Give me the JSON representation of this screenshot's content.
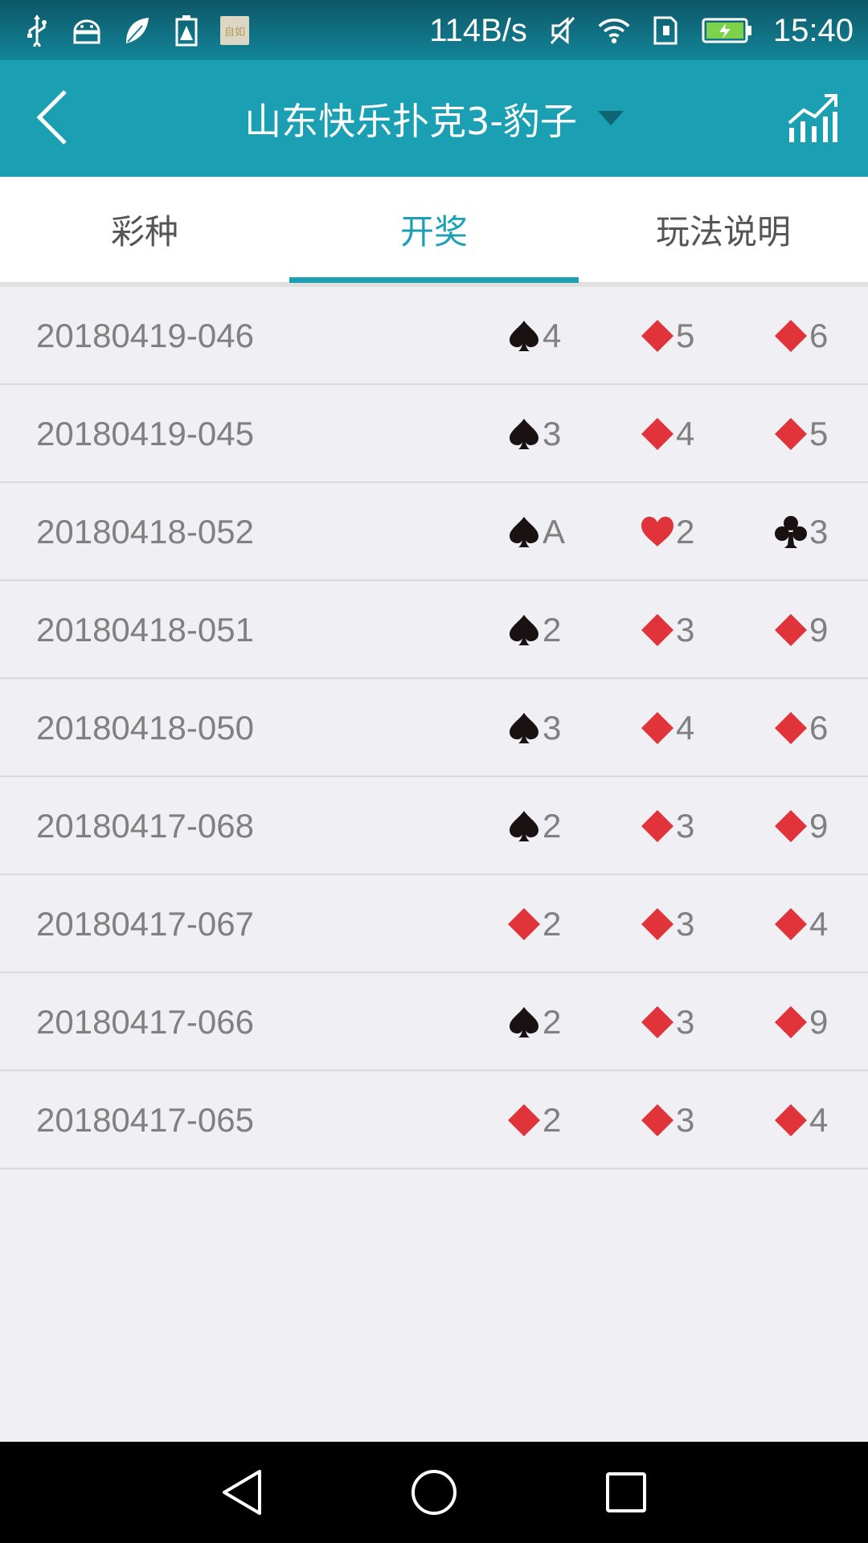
{
  "status_bar": {
    "net_speed": "114B/s",
    "time": "15:40",
    "notif_thumb_text": "自如",
    "icons": [
      "usb-icon",
      "android-icon",
      "leaf-icon",
      "battery-warning-icon",
      "notification-thumb",
      "mute-icon",
      "wifi-icon",
      "sim-icon",
      "battery-charging-icon"
    ]
  },
  "header": {
    "title": "山东快乐扑克3-豹子",
    "back_icon": "back-arrow-icon",
    "dropdown_icon": "dropdown-triangle-icon",
    "chart_icon": "trend-chart-icon"
  },
  "tabs": [
    {
      "label": "彩种",
      "active": false
    },
    {
      "label": "开奖",
      "active": true
    },
    {
      "label": "玩法说明",
      "active": false
    }
  ],
  "colors": {
    "accent": "#1a9fb3",
    "red_suit": "#e0343a",
    "black_suit": "#1a1212",
    "text_gray": "#808080"
  },
  "results": [
    {
      "issue": "20180419-046",
      "cards": [
        {
          "suit": "spade",
          "rank": "4"
        },
        {
          "suit": "diamond",
          "rank": "5"
        },
        {
          "suit": "diamond",
          "rank": "6"
        }
      ]
    },
    {
      "issue": "20180419-045",
      "cards": [
        {
          "suit": "spade",
          "rank": "3"
        },
        {
          "suit": "diamond",
          "rank": "4"
        },
        {
          "suit": "diamond",
          "rank": "5"
        }
      ]
    },
    {
      "issue": "20180418-052",
      "cards": [
        {
          "suit": "spade",
          "rank": "A"
        },
        {
          "suit": "heart",
          "rank": "2"
        },
        {
          "suit": "club",
          "rank": "3"
        }
      ]
    },
    {
      "issue": "20180418-051",
      "cards": [
        {
          "suit": "spade",
          "rank": "2"
        },
        {
          "suit": "diamond",
          "rank": "3"
        },
        {
          "suit": "diamond",
          "rank": "9"
        }
      ]
    },
    {
      "issue": "20180418-050",
      "cards": [
        {
          "suit": "spade",
          "rank": "3"
        },
        {
          "suit": "diamond",
          "rank": "4"
        },
        {
          "suit": "diamond",
          "rank": "6"
        }
      ]
    },
    {
      "issue": "20180417-068",
      "cards": [
        {
          "suit": "spade",
          "rank": "2"
        },
        {
          "suit": "diamond",
          "rank": "3"
        },
        {
          "suit": "diamond",
          "rank": "9"
        }
      ]
    },
    {
      "issue": "20180417-067",
      "cards": [
        {
          "suit": "diamond",
          "rank": "2"
        },
        {
          "suit": "diamond",
          "rank": "3"
        },
        {
          "suit": "diamond",
          "rank": "4"
        }
      ]
    },
    {
      "issue": "20180417-066",
      "cards": [
        {
          "suit": "spade",
          "rank": "2"
        },
        {
          "suit": "diamond",
          "rank": "3"
        },
        {
          "suit": "diamond",
          "rank": "9"
        }
      ]
    },
    {
      "issue": "20180417-065",
      "cards": [
        {
          "suit": "diamond",
          "rank": "2"
        },
        {
          "suit": "diamond",
          "rank": "3"
        },
        {
          "suit": "diamond",
          "rank": "4"
        }
      ]
    }
  ],
  "nav_bar": {
    "icons": [
      "nav-back-icon",
      "nav-home-icon",
      "nav-recents-icon"
    ]
  }
}
